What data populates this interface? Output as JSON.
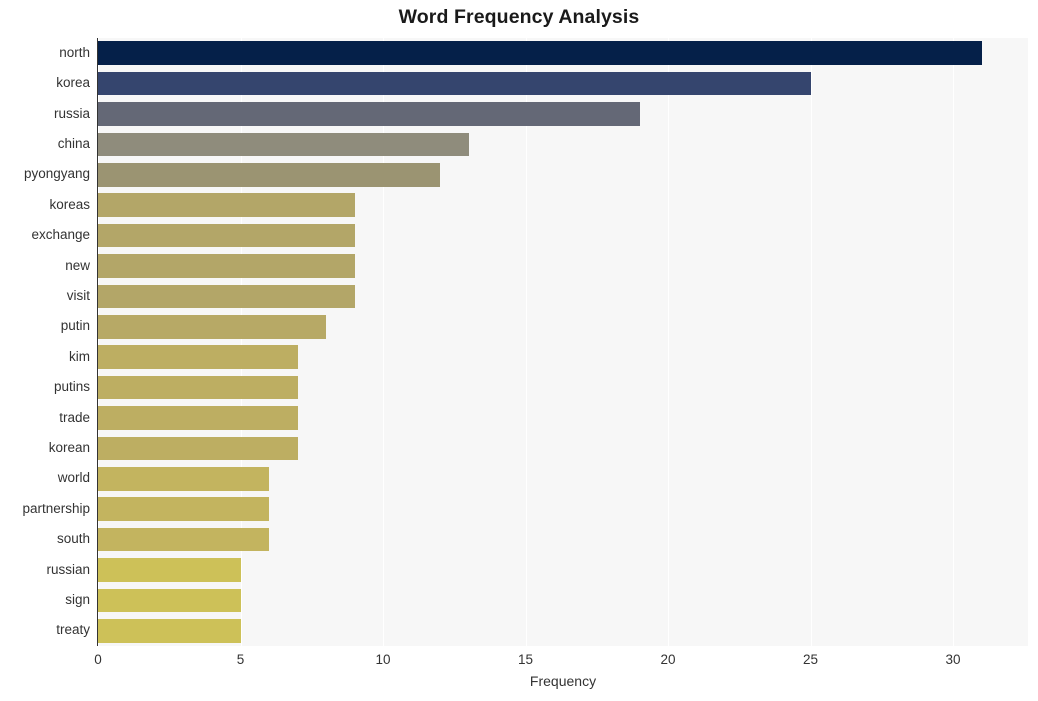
{
  "chart_data": {
    "type": "bar",
    "orientation": "horizontal",
    "title": "Word Frequency Analysis",
    "xlabel": "Frequency",
    "ylabel": "",
    "categories": [
      "north",
      "korea",
      "russia",
      "china",
      "pyongyang",
      "koreas",
      "exchange",
      "new",
      "visit",
      "putin",
      "kim",
      "putins",
      "trade",
      "korean",
      "world",
      "partnership",
      "south",
      "russian",
      "sign",
      "treaty"
    ],
    "values": [
      31,
      25,
      19,
      13,
      12,
      9,
      9,
      9,
      9,
      8,
      7,
      7,
      7,
      7,
      6,
      6,
      6,
      5,
      5,
      5
    ],
    "bar_colors": [
      "#052049",
      "#35456e",
      "#646876",
      "#8f8c7c",
      "#9b9472",
      "#b3a668",
      "#b3a668",
      "#b3a668",
      "#b3a668",
      "#b7a966",
      "#bdae62",
      "#bdae62",
      "#bdae62",
      "#bdae62",
      "#c3b45f",
      "#c3b45f",
      "#c3b45f",
      "#cdc158",
      "#cdc158",
      "#cdc158"
    ],
    "xlim": [
      0,
      32.63
    ],
    "xticks": [
      0,
      5,
      10,
      15,
      20,
      25,
      30
    ],
    "xtick_labels": [
      "0",
      "5",
      "10",
      "15",
      "20",
      "25",
      "30"
    ],
    "grid": "vertical-white",
    "legend": "none",
    "plot_background": "#f7f7f7",
    "figure_background": "#ffffff",
    "tick_color": "#333333",
    "title_color": "#1a1a1a"
  }
}
